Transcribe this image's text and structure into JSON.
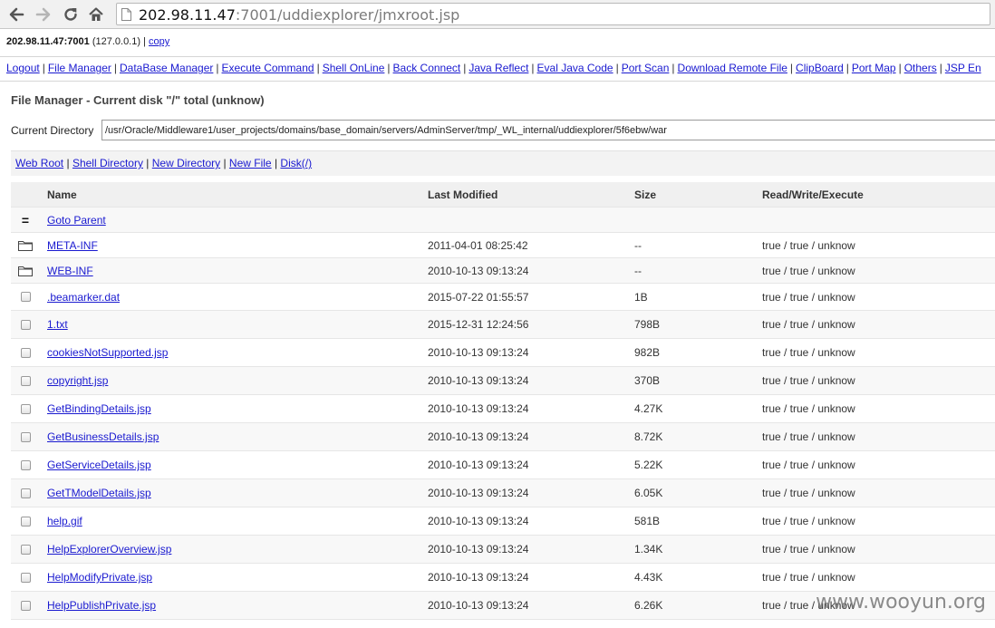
{
  "browser": {
    "url_host": "202.98.11.47",
    "url_rest": ":7001/uddiexplorer/jmxroot.jsp"
  },
  "hostline": {
    "host": "202.98.11.47:7001",
    "local": " (127.0.0.1) | ",
    "copy": "copy"
  },
  "menu": [
    "Logout",
    "File Manager",
    "DataBase Manager",
    "Execute Command",
    "Shell OnLine",
    "Back Connect",
    "Java Reflect",
    "Eval Java Code",
    "Port Scan",
    "Download Remote File",
    "ClipBoard",
    "Port Map",
    "Others",
    "JSP En"
  ],
  "title": "File Manager - Current disk \"/\" total (unknow)",
  "current_directory": {
    "label": "Current Directory",
    "value": "/usr/Oracle/Middleware1/user_projects/domains/base_domain/servers/AdminServer/tmp/_WL_internal/uddiexplorer/5f6ebw/war"
  },
  "links": [
    "Web Root",
    "Shell Directory",
    "New Directory",
    "New File",
    "Disk(/)"
  ],
  "table": {
    "headers": {
      "name": "Name",
      "modified": "Last Modified",
      "size": "Size",
      "rwx": "Read/Write/Execute"
    },
    "parent": {
      "glyph": "=",
      "label": "Goto Parent"
    },
    "rows": [
      {
        "type": "folder",
        "name": "META-INF",
        "modified": "2011-04-01 08:25:42",
        "size": "--",
        "rwx": "true / true / unknow"
      },
      {
        "type": "folder",
        "name": "WEB-INF",
        "modified": "2010-10-13 09:13:24",
        "size": "--",
        "rwx": "true / true / unknow"
      },
      {
        "type": "file",
        "name": ".beamarker.dat",
        "modified": "2015-07-22 01:55:57",
        "size": "1B",
        "rwx": "true / true / unknow"
      },
      {
        "type": "file",
        "name": "1.txt",
        "modified": "2015-12-31 12:24:56",
        "size": "798B",
        "rwx": "true / true / unknow"
      },
      {
        "type": "file",
        "name": "cookiesNotSupported.jsp",
        "modified": "2010-10-13 09:13:24",
        "size": "982B",
        "rwx": "true / true / unknow"
      },
      {
        "type": "file",
        "name": "copyright.jsp",
        "modified": "2010-10-13 09:13:24",
        "size": "370B",
        "rwx": "true / true / unknow"
      },
      {
        "type": "file",
        "name": "GetBindingDetails.jsp",
        "modified": "2010-10-13 09:13:24",
        "size": "4.27K",
        "rwx": "true / true / unknow"
      },
      {
        "type": "file",
        "name": "GetBusinessDetails.jsp",
        "modified": "2010-10-13 09:13:24",
        "size": "8.72K",
        "rwx": "true / true / unknow"
      },
      {
        "type": "file",
        "name": "GetServiceDetails.jsp",
        "modified": "2010-10-13 09:13:24",
        "size": "5.22K",
        "rwx": "true / true / unknow"
      },
      {
        "type": "file",
        "name": "GetTModelDetails.jsp",
        "modified": "2010-10-13 09:13:24",
        "size": "6.05K",
        "rwx": "true / true / unknow"
      },
      {
        "type": "file",
        "name": "help.gif",
        "modified": "2010-10-13 09:13:24",
        "size": "581B",
        "rwx": "true / true / unknow"
      },
      {
        "type": "file",
        "name": "HelpExplorerOverview.jsp",
        "modified": "2010-10-13 09:13:24",
        "size": "1.34K",
        "rwx": "true / true / unknow"
      },
      {
        "type": "file",
        "name": "HelpModifyPrivate.jsp",
        "modified": "2010-10-13 09:13:24",
        "size": "4.43K",
        "rwx": "true / true / unknow"
      },
      {
        "type": "file",
        "name": "HelpPublishPrivate.jsp",
        "modified": "2010-10-13 09:13:24",
        "size": "6.26K",
        "rwx": "true / true / unknow"
      }
    ]
  },
  "watermark": "www.wooyun.org",
  "colors": {
    "link": "#1a1ad0",
    "row_even": "#f8f8f8",
    "row_odd": "#ffffff"
  }
}
